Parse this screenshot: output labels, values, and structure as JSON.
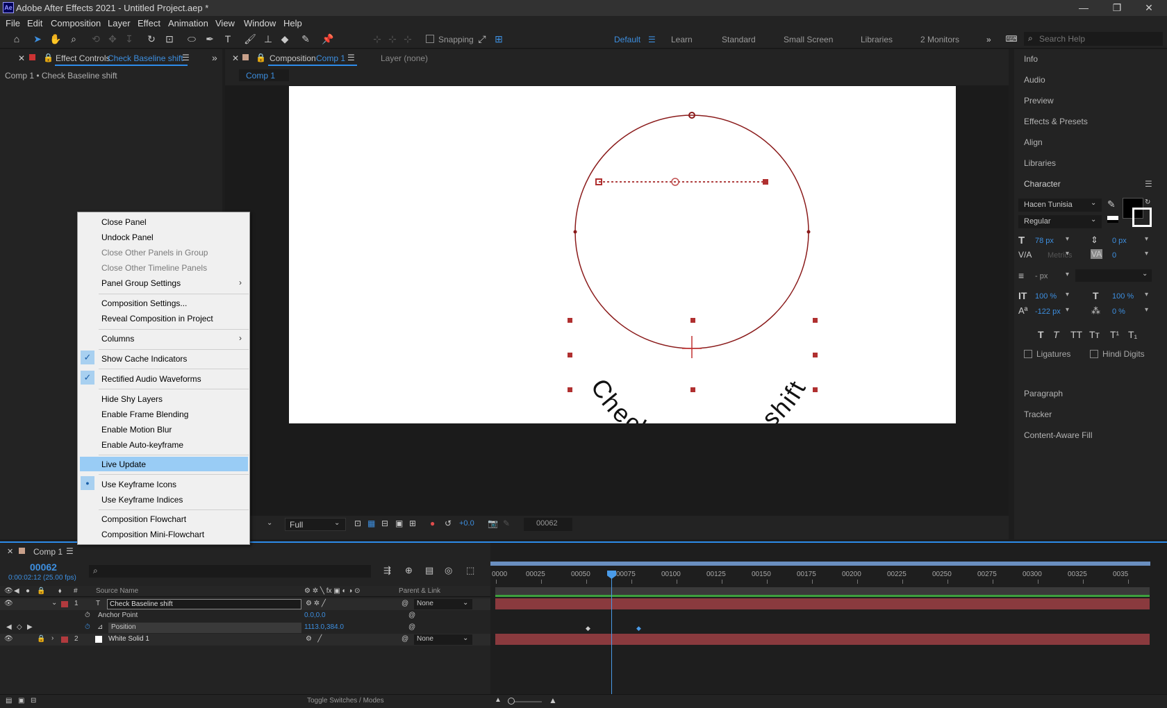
{
  "window": {
    "title": "Adobe After Effects 2021 - Untitled Project.aep *",
    "logo": "Ae",
    "minimize": "—",
    "maximize": "❐",
    "close": "✕"
  },
  "menu": [
    "File",
    "Edit",
    "Composition",
    "Layer",
    "Effect",
    "Animation",
    "View",
    "Window",
    "Help"
  ],
  "toolbar": {
    "snapping_label": "Snapping",
    "workspaces": [
      "Default",
      "Learn",
      "Standard",
      "Small Screen",
      "Libraries",
      "2 Monitors"
    ],
    "active_workspace": "Default",
    "search_placeholder": "Search Help"
  },
  "effect_controls": {
    "tab_label": "Effect Controls",
    "tab_target": "Check Baseline shift",
    "breadcrumb": "Comp 1 • Check Baseline shift"
  },
  "composition_panel": {
    "tab_label": "Composition",
    "tab_target": "Comp 1",
    "layer_tab": "Layer (none)",
    "comp_tab": "Comp 1",
    "canvas_text": "Check Baseline shift",
    "resolution": "Full",
    "exposure": "+0.0",
    "frame": "00062"
  },
  "right_panels": [
    "Info",
    "Audio",
    "Preview",
    "Effects & Presets",
    "Align",
    "Libraries"
  ],
  "character": {
    "title": "Character",
    "font": "Hacen Tunisia",
    "style": "Regular",
    "size": "78 px",
    "leading": "0 px",
    "kerning": "Metrics",
    "tracking": "0",
    "stroke": "- px",
    "vscale": "100 %",
    "hscale": "100 %",
    "baseline": "-122 px",
    "tsume": "0 %",
    "ligatures": "Ligatures",
    "hindi_digits": "Hindi Digits",
    "style_buttons": [
      "T",
      "T",
      "TT",
      "Tт",
      "T¹",
      "T₁"
    ]
  },
  "lower_panels": [
    "Paragraph",
    "Tracker",
    "Content-Aware Fill"
  ],
  "context_menu": {
    "items": [
      {
        "label": "Close Panel",
        "state": "enabled"
      },
      {
        "label": "Undock Panel",
        "state": "enabled"
      },
      {
        "label": "Close Other Panels in Group",
        "state": "disabled"
      },
      {
        "label": "Close Other Timeline Panels",
        "state": "disabled"
      },
      {
        "label": "Panel Group Settings",
        "state": "submenu"
      },
      {
        "label": "Composition Settings...",
        "state": "enabled"
      },
      {
        "label": "Reveal Composition in Project",
        "state": "enabled"
      },
      {
        "label": "Columns",
        "state": "submenu"
      },
      {
        "label": "Show Cache Indicators",
        "state": "checked"
      },
      {
        "label": "Rectified Audio Waveforms",
        "state": "checked"
      },
      {
        "label": "Hide Shy Layers",
        "state": "enabled"
      },
      {
        "label": "Enable Frame Blending",
        "state": "enabled"
      },
      {
        "label": "Enable Motion Blur",
        "state": "enabled"
      },
      {
        "label": "Enable Auto-keyframe",
        "state": "enabled"
      },
      {
        "label": "Live Update",
        "state": "highlighted"
      },
      {
        "label": "Use Keyframe Icons",
        "state": "selected-radio"
      },
      {
        "label": "Use Keyframe Indices",
        "state": "enabled"
      },
      {
        "label": "Composition Flowchart",
        "state": "enabled"
      },
      {
        "label": "Composition Mini-Flowchart",
        "state": "enabled"
      }
    ]
  },
  "timeline": {
    "tab_label": "Comp 1",
    "timecode": "00062",
    "timecode_sub": "0:00:02:12 (25.00 fps)",
    "search_placeholder": "",
    "col_source": "Source Name",
    "col_parent": "Parent & Link",
    "ruler": [
      "0000",
      "00025",
      "00050",
      "00075",
      "00100",
      "00125",
      "00150",
      "00175",
      "00200",
      "00225",
      "00250",
      "00275",
      "00300",
      "00325",
      "0035"
    ],
    "layers": [
      {
        "num": "1",
        "name": "Check Baseline shift",
        "parent": "None"
      },
      {
        "num": "2",
        "name": "White Solid 1",
        "parent": "None"
      }
    ],
    "props": [
      {
        "name": "Anchor Point",
        "value": "0.0,0.0"
      },
      {
        "name": "Position",
        "value": "1113.0,384.0"
      }
    ],
    "toggle_label": "Toggle Switches / Modes"
  },
  "colors": {
    "accent": "#2d8ceb",
    "label_red": "#b13a3e",
    "layer_bar": "#8a3a3e"
  }
}
